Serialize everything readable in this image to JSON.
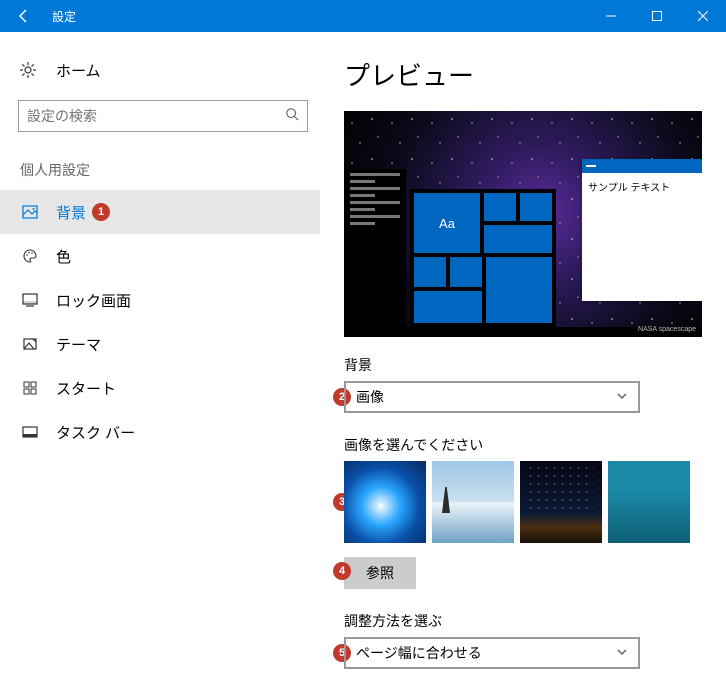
{
  "titlebar": {
    "title": "設定"
  },
  "sidebar": {
    "home": "ホーム",
    "search_placeholder": "設定の検索",
    "group": "個人用設定",
    "items": [
      {
        "label": "背景"
      },
      {
        "label": "色"
      },
      {
        "label": "ロック画面"
      },
      {
        "label": "テーマ"
      },
      {
        "label": "スタート"
      },
      {
        "label": "タスク バー"
      }
    ]
  },
  "main": {
    "preview_heading": "プレビュー",
    "sample_text": "サンプル テキスト",
    "aa": "Aa",
    "watermark1": "NASA spacescape",
    "background_label": "背景",
    "background_value": "画像",
    "choose_image_label": "画像を選んでください",
    "browse": "参照",
    "fit_label": "調整方法を選ぶ",
    "fit_value": "ページ幅に合わせる"
  },
  "annotations": {
    "n1": "1",
    "n2": "2",
    "n3": "3",
    "n4": "4",
    "n5": "5"
  }
}
